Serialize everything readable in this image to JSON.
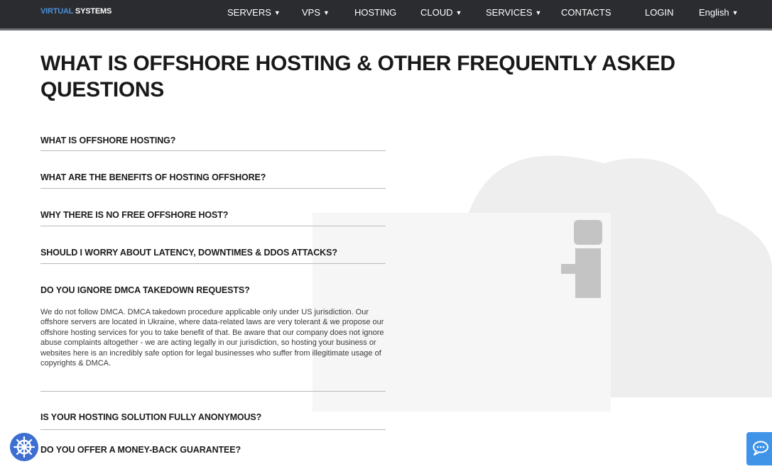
{
  "brand": {
    "logo_accent": "VIRTUAL",
    "logo_text": " SYSTEMS"
  },
  "nav": {
    "servers": "SERVERS",
    "vps": "VPS",
    "hosting": "HOSTING",
    "cloud": "CLOUD",
    "services": "SERVICES",
    "contacts": "CONTACTS",
    "login": "LOGIN",
    "language": "English"
  },
  "page": {
    "title": "WHAT IS OFFSHORE HOSTING & OTHER FREQUENTLY ASKED QUESTIONS"
  },
  "faq": [
    {
      "question": "WHAT IS OFFSHORE HOSTING?"
    },
    {
      "question": "WHAT ARE THE BENEFITS OF HOSTING OFFSHORE?"
    },
    {
      "question": "WHY THERE IS NO FREE OFFSHORE HOST?"
    },
    {
      "question": "SHOULD I WORRY ABOUT LATENCY, DOWNTIMES & DDOS ATTACKS?"
    },
    {
      "question": "DO YOU IGNORE DMCA TAKEDOWN REQUESTS?",
      "answer": "We do not follow DMCA. DMCA takedown procedure applicable only under US jurisdiction. Our offshore servers are located in Ukraine, where data-related laws are very tolerant & we propose our offshore hosting services for you to take benefit of that. Be aware that our company does not ignore abuse complaints altogether - we are acting legally in our jurisdiction, so hosting your business or websites here is an incredibly safe option for legal businesses who suffer from illegitimate usage of copyrights & DMCA."
    },
    {
      "question": "IS YOUR HOSTING SOLUTION FULLY ANONYMOUS?"
    },
    {
      "question": "DO YOU OFFER A MONEY-BACK GUARANTEE?"
    }
  ],
  "icons": {
    "dropdown": "caret-down-icon",
    "helm": "helm-wheel-icon",
    "chat": "chat-bubble-icon",
    "background": "cloud-info-icon"
  },
  "colors": {
    "navbar": "#2a2c30",
    "logo_accent": "#4b8fd9",
    "chat_widget": "#3f94e8",
    "helm_icon": "#3d6fd1"
  }
}
